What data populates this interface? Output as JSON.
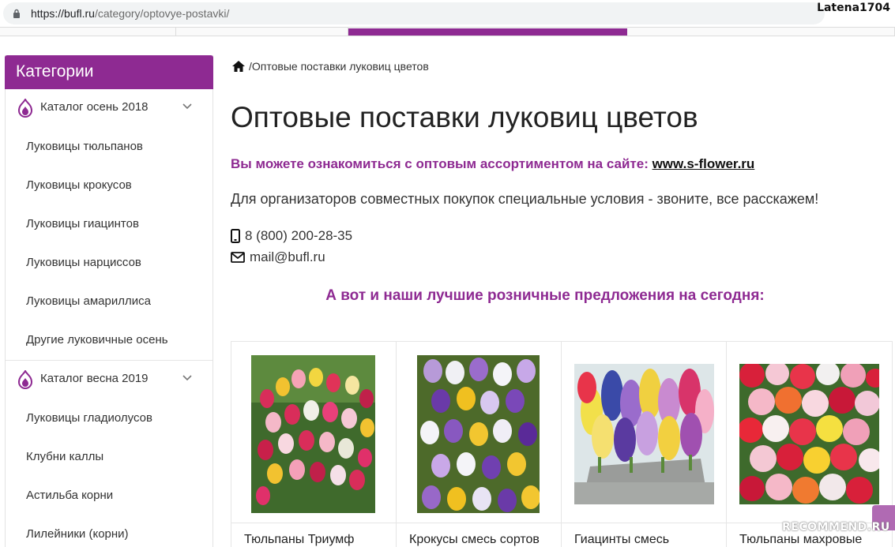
{
  "browser": {
    "url_domain": "https://bufl.ru",
    "url_path": "/category/optovye-postavki/",
    "user": "Latena1704"
  },
  "sidebar": {
    "title": "Категории",
    "catalogs": [
      {
        "label": "Каталог осень 2018",
        "items": [
          "Луковицы тюльпанов",
          "Луковицы крокусов",
          "Луковицы гиацинтов",
          "Луковицы нарциссов",
          "Луковицы амариллиса",
          "Другие луковичные осень"
        ]
      },
      {
        "label": "Каталог весна 2019",
        "items": [
          "Луковицы гладиолусов",
          "Клубни каллы",
          "Астильба корни",
          "Лилейники (корни)"
        ]
      }
    ]
  },
  "breadcrumb": {
    "separator": "/",
    "current": "Оптовые поставки луковиц цветов"
  },
  "page": {
    "title": "Оптовые поставки луковиц цветов",
    "promo_text": "Вы можете ознакомиться с оптовым ассортиментом на сайте: ",
    "promo_link": "www.s-flower.ru",
    "coop_text": "Для организаторов совместных покупок специальные условия - звоните, все расскажем!",
    "phone": "8 (800) 200-28-35",
    "email": "mail@bufl.ru",
    "offers_heading": "А вот и наши лучшие розничные предложения на сегодня:"
  },
  "products": [
    {
      "name": "Тюльпаны Триумф"
    },
    {
      "name": "Крокусы смесь сортов"
    },
    {
      "name": "Гиацинты смесь"
    },
    {
      "name": "Тюльпаны махровые"
    }
  ],
  "watermark": "RECOMMEND.RU",
  "colors": {
    "accent": "#8e2a92"
  }
}
